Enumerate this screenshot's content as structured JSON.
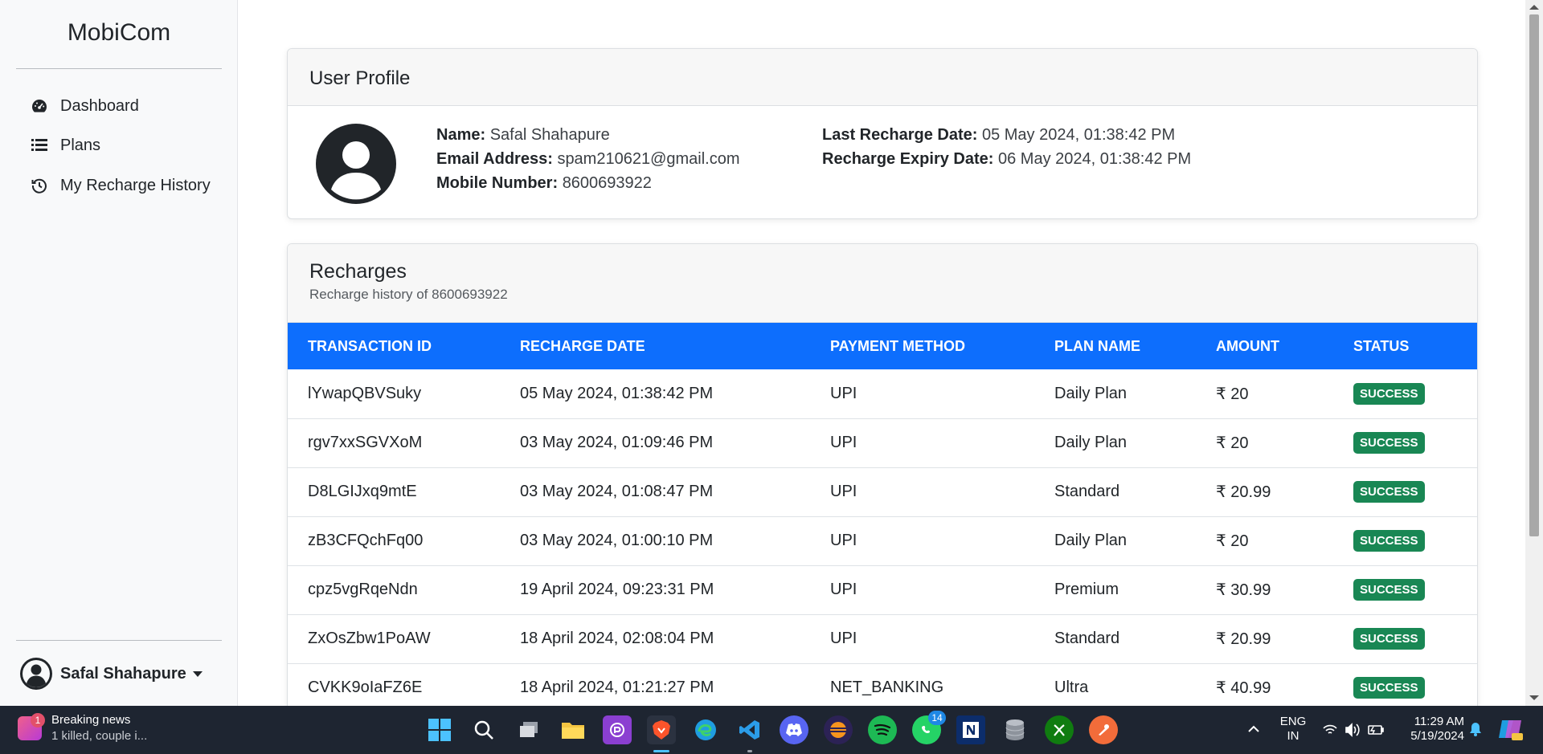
{
  "sidebar": {
    "brand": "MobiCom",
    "items": [
      {
        "label": "Dashboard",
        "icon": "dashboard-gauge-icon"
      },
      {
        "label": "Plans",
        "icon": "list-icon"
      },
      {
        "label": "My Recharge History",
        "icon": "history-icon"
      }
    ],
    "user_name": "Safal Shahapure"
  },
  "profile": {
    "title": "User Profile",
    "name_label": "Name:",
    "name": "Safal Shahapure",
    "email_label": "Email Address:",
    "email": "spam210621@gmail.com",
    "mobile_label": "Mobile Number:",
    "mobile": "8600693922",
    "last_recharge_label": "Last Recharge Date:",
    "last_recharge": "05 May 2024, 01:38:42 PM",
    "expiry_label": "Recharge Expiry Date:",
    "expiry": "06 May 2024, 01:38:42 PM"
  },
  "recharges": {
    "title": "Recharges",
    "subtitle": "Recharge history of 8600693922",
    "columns": [
      "TRANSACTION ID",
      "RECHARGE DATE",
      "PAYMENT METHOD",
      "PLAN NAME",
      "AMOUNT",
      "STATUS"
    ],
    "rows": [
      [
        "lYwapQBVSuky",
        "05 May 2024, 01:38:42 PM",
        "UPI",
        "Daily Plan",
        "₹ 20",
        "SUCCESS"
      ],
      [
        "rgv7xxSGVXoM",
        "03 May 2024, 01:09:46 PM",
        "UPI",
        "Daily Plan",
        "₹ 20",
        "SUCCESS"
      ],
      [
        "D8LGIJxq9mtE",
        "03 May 2024, 01:08:47 PM",
        "UPI",
        "Standard",
        "₹ 20.99",
        "SUCCESS"
      ],
      [
        "zB3CFQchFq00",
        "03 May 2024, 01:00:10 PM",
        "UPI",
        "Daily Plan",
        "₹ 20",
        "SUCCESS"
      ],
      [
        "cpz5vgRqeNdn",
        "19 April 2024, 09:23:31 PM",
        "UPI",
        "Premium",
        "₹ 30.99",
        "SUCCESS"
      ],
      [
        "ZxOsZbw1PoAW",
        "18 April 2024, 02:08:04 PM",
        "UPI",
        "Standard",
        "₹ 20.99",
        "SUCCESS"
      ],
      [
        "CVKK9oIaFZ6E",
        "18 April 2024, 01:21:27 PM",
        "NET_BANKING",
        "Ultra",
        "₹ 40.99",
        "SUCCESS"
      ]
    ]
  },
  "taskbar": {
    "news_title": "Breaking news",
    "news_text": "1 killed, couple i...",
    "news_badge": "1",
    "whatsapp_badge": "14",
    "lang_top": "ENG",
    "lang_bottom": "IN",
    "time": "11:29 AM",
    "date": "5/19/2024"
  },
  "colors": {
    "table_header": "#0d6efd",
    "success_badge": "#198754",
    "sidebar_bg": "#f8f9fa",
    "taskbar_bg": "#1e2531"
  }
}
